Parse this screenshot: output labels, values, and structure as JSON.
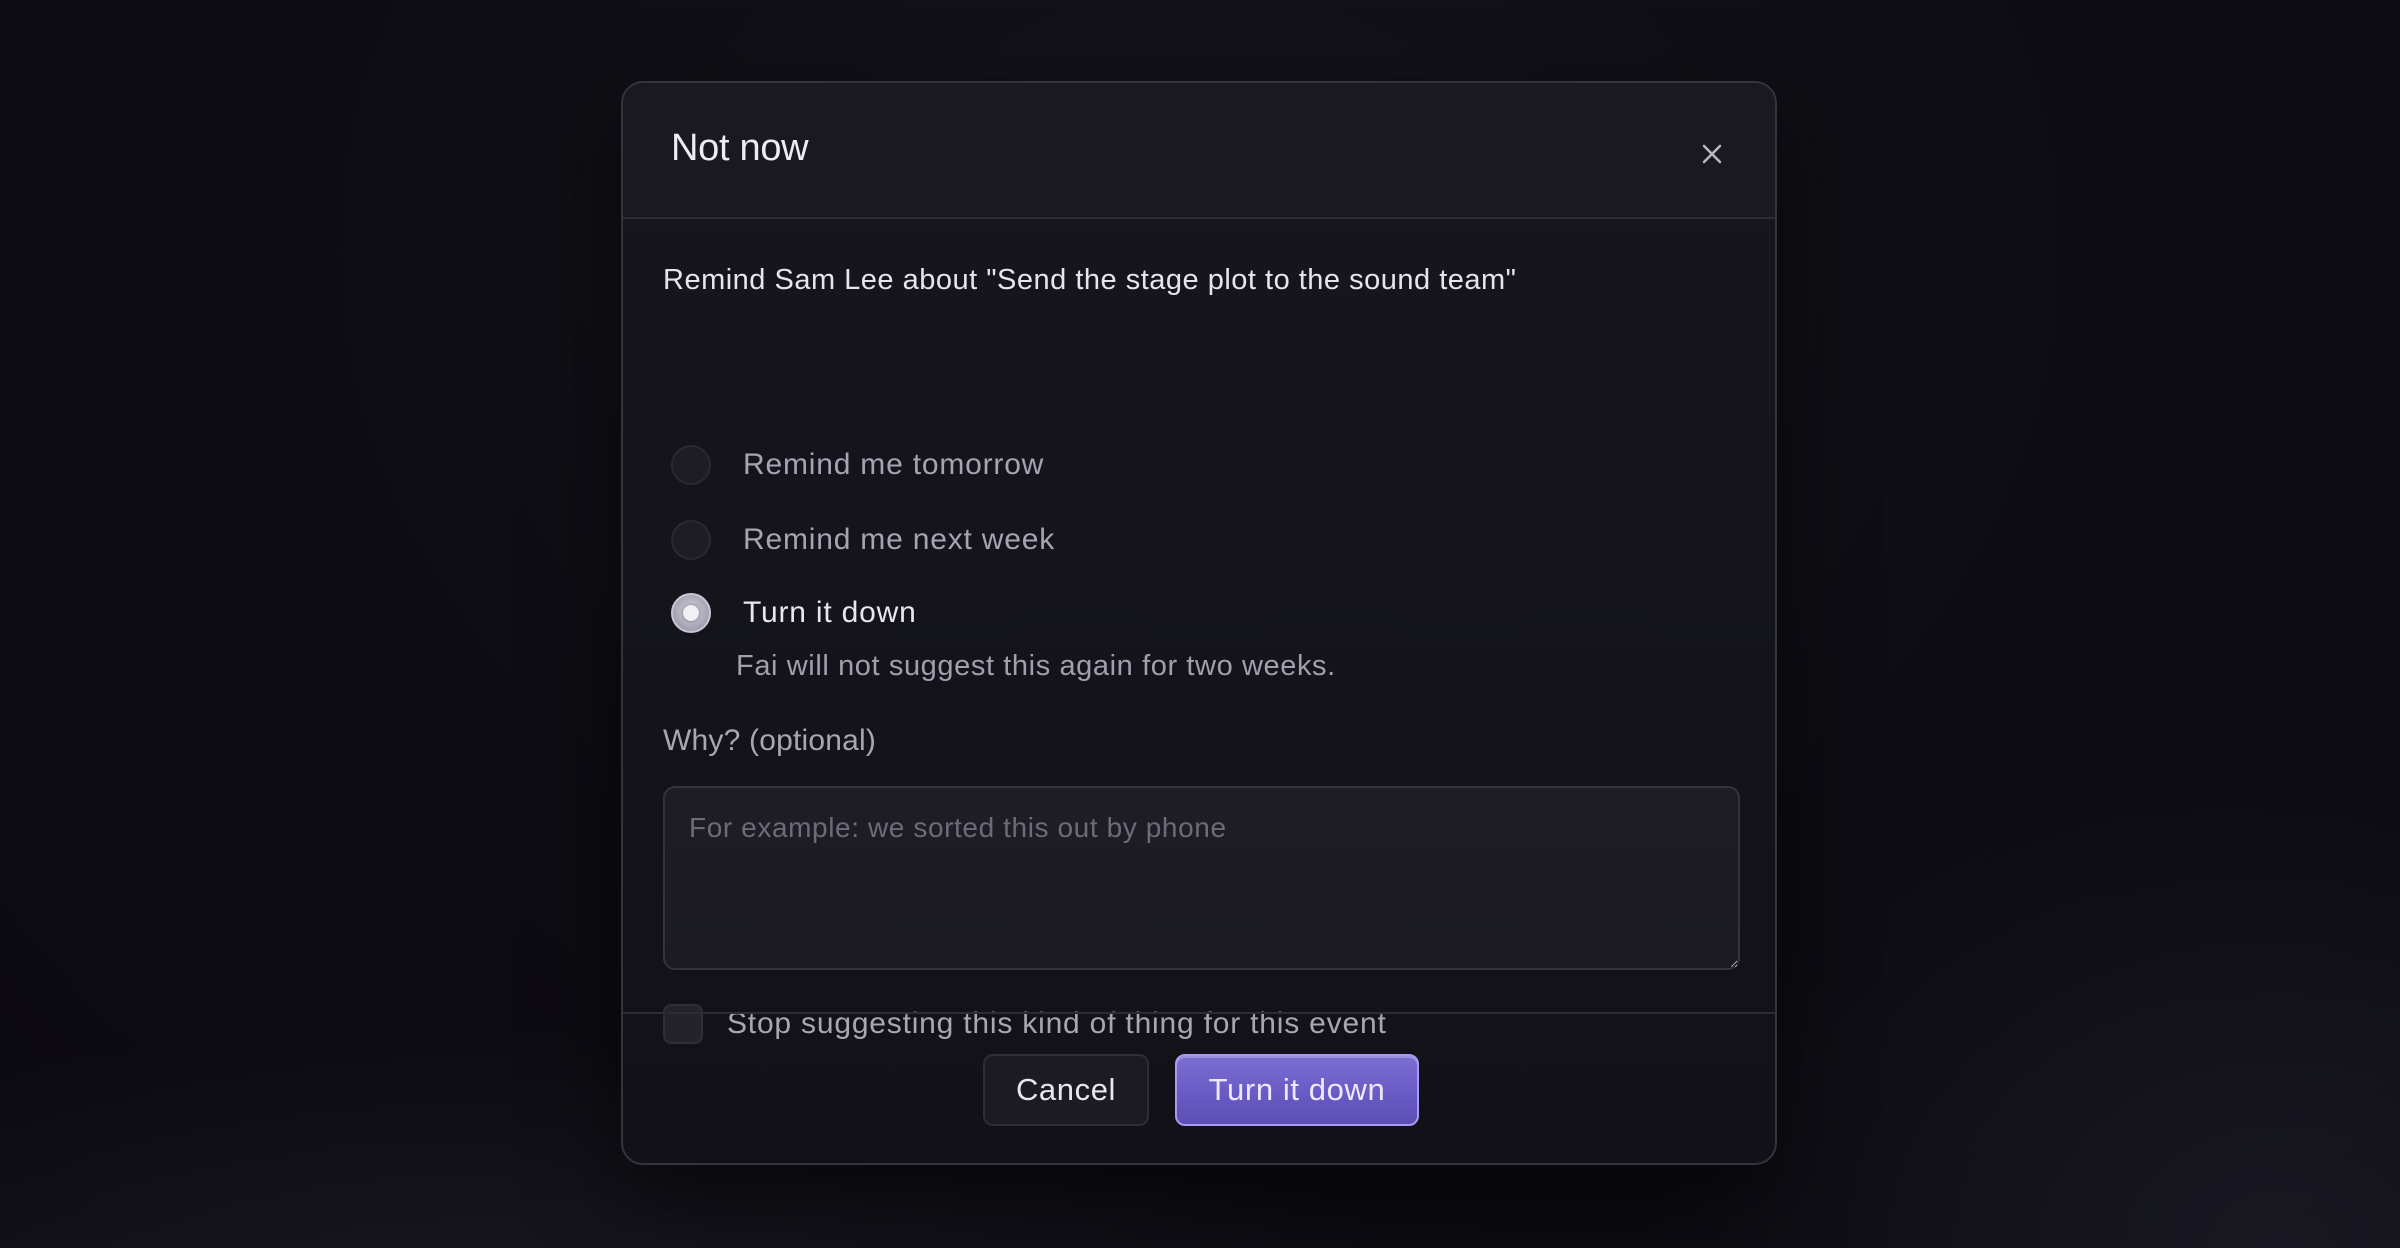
{
  "dialog": {
    "title": "Not now",
    "close_icon": "close-icon",
    "prompt": "Remind Sam Lee about \"Send the stage plot to the sound team\"",
    "options": [
      {
        "label": "Remind me tomorrow",
        "selected": false
      },
      {
        "label": "Remind me next week",
        "selected": false
      },
      {
        "label": "Turn it down",
        "selected": true
      }
    ],
    "selected_hint": "Fai will not suggest this again for two weeks.",
    "reason": {
      "label": "Why? (optional)",
      "placeholder": "For example: we sorted this out by phone",
      "value": ""
    },
    "stop_suggesting": {
      "label": "Stop suggesting this kind of thing for this event",
      "checked": false
    },
    "buttons": {
      "cancel": "Cancel",
      "confirm": "Turn it down"
    }
  },
  "colors": {
    "accent": "#6a5bc5",
    "accent_border": "#a59bf0",
    "background": "#0d0c12",
    "dialog": "#17161e"
  }
}
